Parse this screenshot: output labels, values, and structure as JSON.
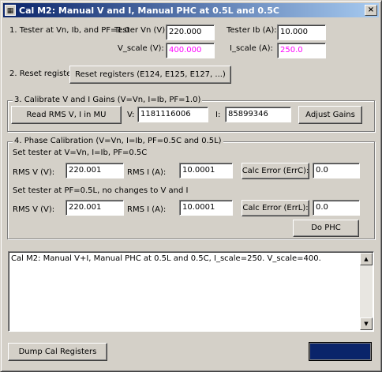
{
  "window": {
    "title": "Cal M2: Manual V and I, Manual PHC at 0.5L and 0.5C",
    "app_icon": "calibration-app-icon",
    "close_label": "×"
  },
  "step1": {
    "label": "1. Tester at Vn, Ib, and PF=1.0",
    "tester_vn_label": "Tester Vn (V):",
    "tester_vn_value": "220.000",
    "tester_ib_label": "Tester Ib (A):",
    "tester_ib_value": "10.000",
    "v_scale_label": "V_scale (V):",
    "v_scale_value": "400.000",
    "i_scale_label": "I_scale (A):",
    "i_scale_value": "250.0"
  },
  "step2": {
    "label": "2. Reset registers",
    "reset_button": "Reset registers (E124, E125, E127, ...)"
  },
  "step3": {
    "title": "3. Calibrate V and I Gains (V=Vn, I=Ib, PF=1.0)",
    "read_button": "Read RMS V, I in MU",
    "v_label": "V:",
    "v_value": "1181116006",
    "i_label": "I:",
    "i_value": "85899346",
    "adjust_button": "Adjust Gains"
  },
  "step4": {
    "title": "4. Phase Calibration (V=Vn, I=Ib, PF=0.5C and 0.5L)",
    "c_instruction": "Set tester at V=Vn, I=Ib, PF=0.5C",
    "c_rms_v_label": "RMS V (V):",
    "c_rms_v_value": "220.001",
    "c_rms_i_label": "RMS I (A):",
    "c_rms_i_value": "10.0001",
    "c_calc_button": "Calc Error (ErrC):",
    "c_err_value": "0.0",
    "l_instruction": "Set tester at PF=0.5L, no changes to V and I",
    "l_rms_v_label": "RMS V (V):",
    "l_rms_v_value": "220.001",
    "l_rms_i_label": "RMS I (A):",
    "l_rms_i_value": "10.0001",
    "l_calc_button": "Calc Error (ErrL):",
    "l_err_value": "0.0",
    "do_phc_button": "Do PHC"
  },
  "log": {
    "text": "Cal M2: Manual V+I, Manual PHC at 0.5L and 0.5C, I_scale=250. V_scale=400.",
    "scroll_up_icon": "▲",
    "scroll_down_icon": "▼"
  },
  "footer": {
    "dump_button": "Dump Cal Registers",
    "ok_button": ""
  },
  "colors": {
    "titlebar_start": "#0a246a",
    "titlebar_end": "#a6caf0",
    "scale_value_text": "#ff00ff",
    "window_bg": "#d4d0c8"
  }
}
